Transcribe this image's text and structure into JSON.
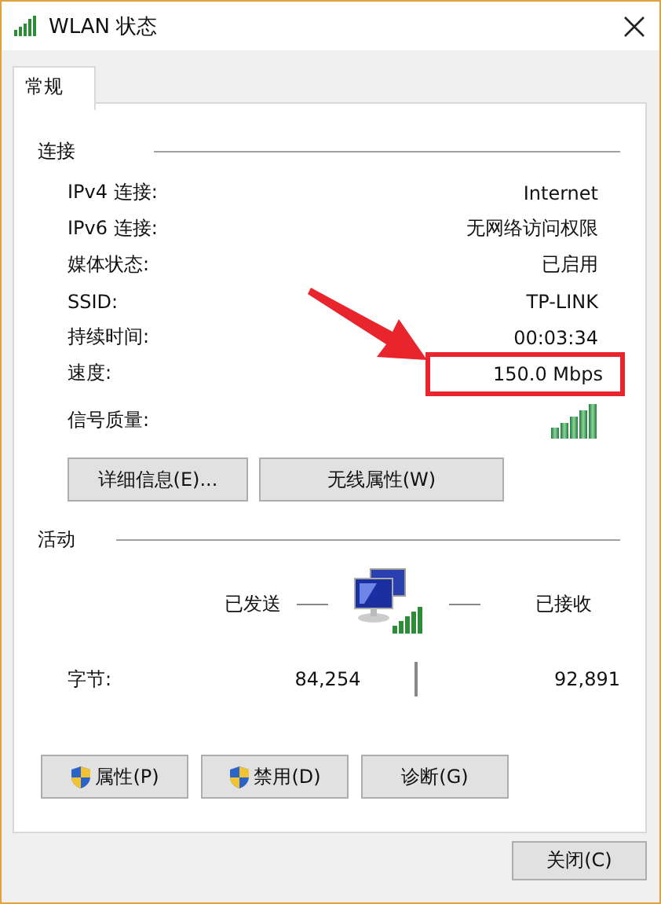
{
  "window": {
    "title": "WLAN 状态"
  },
  "tabs": [
    {
      "label": "常规",
      "selected": true
    }
  ],
  "connection": {
    "heading": "连接",
    "rows": [
      {
        "label": "IPv4 连接:",
        "value": "Internet",
        "highlighted": false
      },
      {
        "label": "IPv6 连接:",
        "value": "无网络访问权限",
        "highlighted": false
      },
      {
        "label": "媒体状态:",
        "value": "已启用",
        "highlighted": false
      },
      {
        "label": "SSID:",
        "value": "TP-LINK",
        "highlighted": false
      },
      {
        "label": "持续时间:",
        "value": "00:03:34",
        "highlighted": false
      },
      {
        "label": "速度:",
        "value": "150.0 Mbps",
        "highlighted": true
      }
    ],
    "signal_label": "信号质量:",
    "buttons": [
      "详细信息(E)...",
      "无线属性(W)"
    ]
  },
  "activity": {
    "heading": "活动",
    "sent_label": "已发送",
    "received_label": "已接收",
    "bytes_label": "字节:",
    "sent": "84,254",
    "received": "92,891",
    "buttons": [
      {
        "label": "属性(P)",
        "shield": true
      },
      {
        "label": "禁用(D)",
        "shield": true
      },
      {
        "label": "诊断(G)",
        "shield": false
      }
    ]
  },
  "footer": {
    "close_button": "关闭(C)"
  }
}
